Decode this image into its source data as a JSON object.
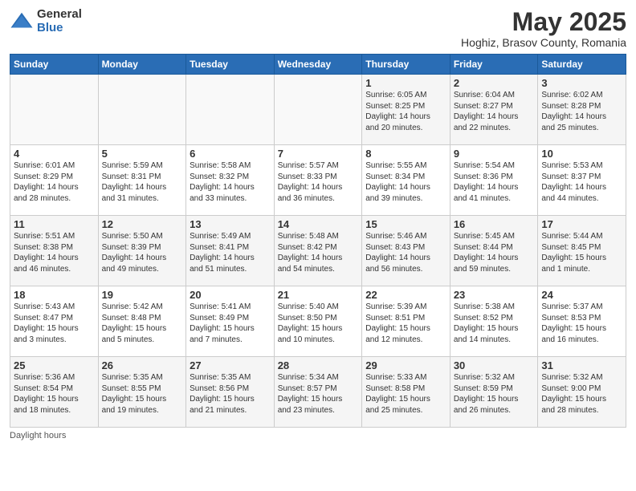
{
  "logo": {
    "general": "General",
    "blue": "Blue"
  },
  "title": "May 2025",
  "location": "Hoghiz, Brasov County, Romania",
  "days_of_week": [
    "Sunday",
    "Monday",
    "Tuesday",
    "Wednesday",
    "Thursday",
    "Friday",
    "Saturday"
  ],
  "footer": "Daylight hours",
  "weeks": [
    [
      {
        "day": "",
        "info": ""
      },
      {
        "day": "",
        "info": ""
      },
      {
        "day": "",
        "info": ""
      },
      {
        "day": "",
        "info": ""
      },
      {
        "day": "1",
        "info": "Sunrise: 6:05 AM\nSunset: 8:25 PM\nDaylight: 14 hours\nand 20 minutes."
      },
      {
        "day": "2",
        "info": "Sunrise: 6:04 AM\nSunset: 8:27 PM\nDaylight: 14 hours\nand 22 minutes."
      },
      {
        "day": "3",
        "info": "Sunrise: 6:02 AM\nSunset: 8:28 PM\nDaylight: 14 hours\nand 25 minutes."
      }
    ],
    [
      {
        "day": "4",
        "info": "Sunrise: 6:01 AM\nSunset: 8:29 PM\nDaylight: 14 hours\nand 28 minutes."
      },
      {
        "day": "5",
        "info": "Sunrise: 5:59 AM\nSunset: 8:31 PM\nDaylight: 14 hours\nand 31 minutes."
      },
      {
        "day": "6",
        "info": "Sunrise: 5:58 AM\nSunset: 8:32 PM\nDaylight: 14 hours\nand 33 minutes."
      },
      {
        "day": "7",
        "info": "Sunrise: 5:57 AM\nSunset: 8:33 PM\nDaylight: 14 hours\nand 36 minutes."
      },
      {
        "day": "8",
        "info": "Sunrise: 5:55 AM\nSunset: 8:34 PM\nDaylight: 14 hours\nand 39 minutes."
      },
      {
        "day": "9",
        "info": "Sunrise: 5:54 AM\nSunset: 8:36 PM\nDaylight: 14 hours\nand 41 minutes."
      },
      {
        "day": "10",
        "info": "Sunrise: 5:53 AM\nSunset: 8:37 PM\nDaylight: 14 hours\nand 44 minutes."
      }
    ],
    [
      {
        "day": "11",
        "info": "Sunrise: 5:51 AM\nSunset: 8:38 PM\nDaylight: 14 hours\nand 46 minutes."
      },
      {
        "day": "12",
        "info": "Sunrise: 5:50 AM\nSunset: 8:39 PM\nDaylight: 14 hours\nand 49 minutes."
      },
      {
        "day": "13",
        "info": "Sunrise: 5:49 AM\nSunset: 8:41 PM\nDaylight: 14 hours\nand 51 minutes."
      },
      {
        "day": "14",
        "info": "Sunrise: 5:48 AM\nSunset: 8:42 PM\nDaylight: 14 hours\nand 54 minutes."
      },
      {
        "day": "15",
        "info": "Sunrise: 5:46 AM\nSunset: 8:43 PM\nDaylight: 14 hours\nand 56 minutes."
      },
      {
        "day": "16",
        "info": "Sunrise: 5:45 AM\nSunset: 8:44 PM\nDaylight: 14 hours\nand 59 minutes."
      },
      {
        "day": "17",
        "info": "Sunrise: 5:44 AM\nSunset: 8:45 PM\nDaylight: 15 hours\nand 1 minute."
      }
    ],
    [
      {
        "day": "18",
        "info": "Sunrise: 5:43 AM\nSunset: 8:47 PM\nDaylight: 15 hours\nand 3 minutes."
      },
      {
        "day": "19",
        "info": "Sunrise: 5:42 AM\nSunset: 8:48 PM\nDaylight: 15 hours\nand 5 minutes."
      },
      {
        "day": "20",
        "info": "Sunrise: 5:41 AM\nSunset: 8:49 PM\nDaylight: 15 hours\nand 7 minutes."
      },
      {
        "day": "21",
        "info": "Sunrise: 5:40 AM\nSunset: 8:50 PM\nDaylight: 15 hours\nand 10 minutes."
      },
      {
        "day": "22",
        "info": "Sunrise: 5:39 AM\nSunset: 8:51 PM\nDaylight: 15 hours\nand 12 minutes."
      },
      {
        "day": "23",
        "info": "Sunrise: 5:38 AM\nSunset: 8:52 PM\nDaylight: 15 hours\nand 14 minutes."
      },
      {
        "day": "24",
        "info": "Sunrise: 5:37 AM\nSunset: 8:53 PM\nDaylight: 15 hours\nand 16 minutes."
      }
    ],
    [
      {
        "day": "25",
        "info": "Sunrise: 5:36 AM\nSunset: 8:54 PM\nDaylight: 15 hours\nand 18 minutes."
      },
      {
        "day": "26",
        "info": "Sunrise: 5:35 AM\nSunset: 8:55 PM\nDaylight: 15 hours\nand 19 minutes."
      },
      {
        "day": "27",
        "info": "Sunrise: 5:35 AM\nSunset: 8:56 PM\nDaylight: 15 hours\nand 21 minutes."
      },
      {
        "day": "28",
        "info": "Sunrise: 5:34 AM\nSunset: 8:57 PM\nDaylight: 15 hours\nand 23 minutes."
      },
      {
        "day": "29",
        "info": "Sunrise: 5:33 AM\nSunset: 8:58 PM\nDaylight: 15 hours\nand 25 minutes."
      },
      {
        "day": "30",
        "info": "Sunrise: 5:32 AM\nSunset: 8:59 PM\nDaylight: 15 hours\nand 26 minutes."
      },
      {
        "day": "31",
        "info": "Sunrise: 5:32 AM\nSunset: 9:00 PM\nDaylight: 15 hours\nand 28 minutes."
      }
    ]
  ]
}
